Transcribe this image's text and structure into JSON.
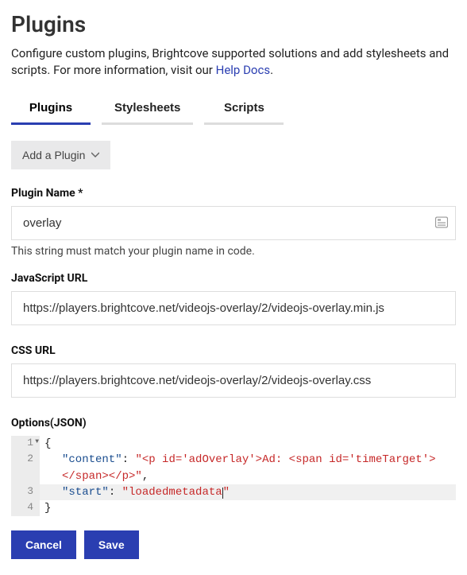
{
  "header": {
    "title": "Plugins",
    "subtitle_prefix": "Configure custom plugins, Brightcove supported solutions and add stylesheets and scripts. For more information, visit our ",
    "help_link": "Help Docs",
    "subtitle_suffix": "."
  },
  "tabs": {
    "plugins": "Plugins",
    "stylesheets": "Stylesheets",
    "scripts": "Scripts"
  },
  "add_plugin_label": "Add a Plugin",
  "fields": {
    "plugin_name_label": "Plugin Name *",
    "plugin_name_value": "overlay",
    "plugin_name_helper": "This string must match your plugin name in code.",
    "js_url_label": "JavaScript URL",
    "js_url_value": "https://players.brightcove.net/videojs-overlay/2/videojs-overlay.min.js",
    "css_url_label": "CSS URL",
    "css_url_value": "https://players.brightcove.net/videojs-overlay/2/videojs-overlay.css",
    "options_label": "Options(JSON)"
  },
  "json_editor": {
    "line1_num": "1",
    "line2_num": "2",
    "line3_num": "3",
    "line4_num": "4",
    "brace_open": "{",
    "brace_close": "}",
    "content_key": "\"content\"",
    "content_val": "\"<p id='adOverlay'>Ad: <span id='timeTarget'></span></p>\"",
    "start_key": "\"start\"",
    "start_val_open": "\"loadedmetadata",
    "start_val_close": "\"",
    "colon": ": ",
    "comma": ","
  },
  "buttons": {
    "cancel": "Cancel",
    "save": "Save"
  }
}
